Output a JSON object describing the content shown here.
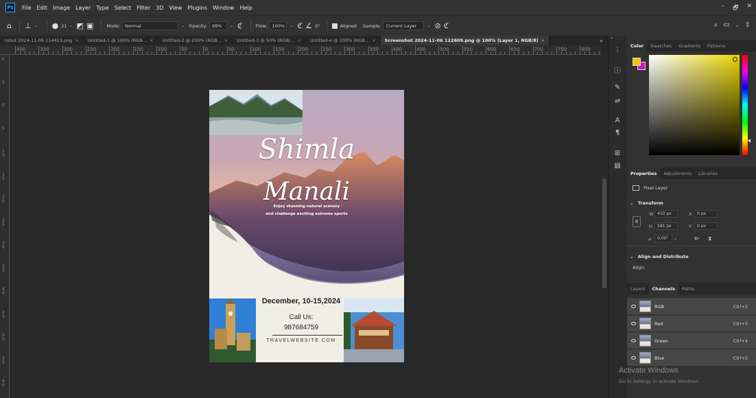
{
  "app": {
    "logo": "Ps"
  },
  "menu": [
    "File",
    "Edit",
    "Image",
    "Layer",
    "Type",
    "Select",
    "Filter",
    "3D",
    "View",
    "Plugins",
    "Window",
    "Help"
  ],
  "window_controls": [
    "–",
    "🗗",
    "✕"
  ],
  "options_bar": {
    "brush_size": "21",
    "mode_label": "Mode:",
    "mode_value": "Normal",
    "opacity_label": "Opacity:",
    "opacity_value": "99%",
    "flow_label": "Flow:",
    "flow_value": "100%",
    "angle_value": "0°",
    "aligned_label": "Aligned",
    "sample_label": "Sample:",
    "sample_value": "Current Layer"
  },
  "doc_tabs": [
    {
      "label": "nshot 2024-11-06 114413.png",
      "active": false
    },
    {
      "label": "Untitled-1 @ 100% (RGB...",
      "active": false
    },
    {
      "label": "Untitled-2 @ 200% (RGB...",
      "active": false
    },
    {
      "label": "Untitled-3 @ 50% (RGB/...",
      "active": false
    },
    {
      "label": "Untitled-4 @ 100% (RGB...",
      "active": false
    },
    {
      "label": "Screenshot 2024-11-06 122609.png @ 100% (Layer 1, RGB/8)",
      "active": true
    }
  ],
  "tab_more": "»",
  "ruler_h_labels": [
    "400",
    "350",
    "300",
    "250",
    "200",
    "150",
    "100",
    "50",
    "0",
    "50",
    "100",
    "150",
    "200",
    "250",
    "300",
    "350",
    "400",
    "450",
    "500",
    "550",
    "600",
    "650",
    "700",
    "750",
    "800"
  ],
  "ruler_v_labels": [
    "0",
    "5",
    "0",
    "5",
    "1 0",
    "1 5",
    "2 0",
    "2 5",
    "3 0",
    "3 5",
    "4 0",
    "4 5",
    "5 0",
    "5 5",
    "6 0"
  ],
  "poster": {
    "title_line1": "Shimla",
    "title_line2": "Manali",
    "tagline_line1": "Enjoy stunning natural scenery",
    "tagline_line2": "and challenge exciting extreme sports",
    "date": "December, 10-15,2024",
    "call_label": "Call Us:",
    "call_number": "987684759",
    "website": "TRAVELWEBSITE.COM"
  },
  "panels": {
    "color_tabs": [
      "Color",
      "Swatches",
      "Gradients",
      "Patterns"
    ],
    "foreground_color": "#f3c20c",
    "background_color": "#d410c8",
    "properties_tabs": [
      "Properties",
      "Adjustments",
      "Libraries"
    ],
    "pixel_layer": "Pixel Layer",
    "transform_title": "Transform",
    "w_label": "W",
    "w_value": "410 px",
    "x_label": "X",
    "x_value": "0 px",
    "h_label": "H",
    "h_value": "581 px",
    "y_label": "Y",
    "y_value": "0 px",
    "angle_value": "0.00°",
    "align_title": "Align and Distribute",
    "align_label": "Align:",
    "layer_tabs": [
      "Layers",
      "Channels",
      "Paths"
    ],
    "channels": [
      {
        "name": "RGB",
        "shortcut": "Ctrl+2"
      },
      {
        "name": "Red",
        "shortcut": "Ctrl+3"
      },
      {
        "name": "Green",
        "shortcut": "Ctrl+4"
      },
      {
        "name": "Blue",
        "shortcut": "Ctrl+5"
      }
    ]
  },
  "watermark": {
    "title": "Activate Windows",
    "subtitle": "Go to Settings to activate Windows."
  }
}
